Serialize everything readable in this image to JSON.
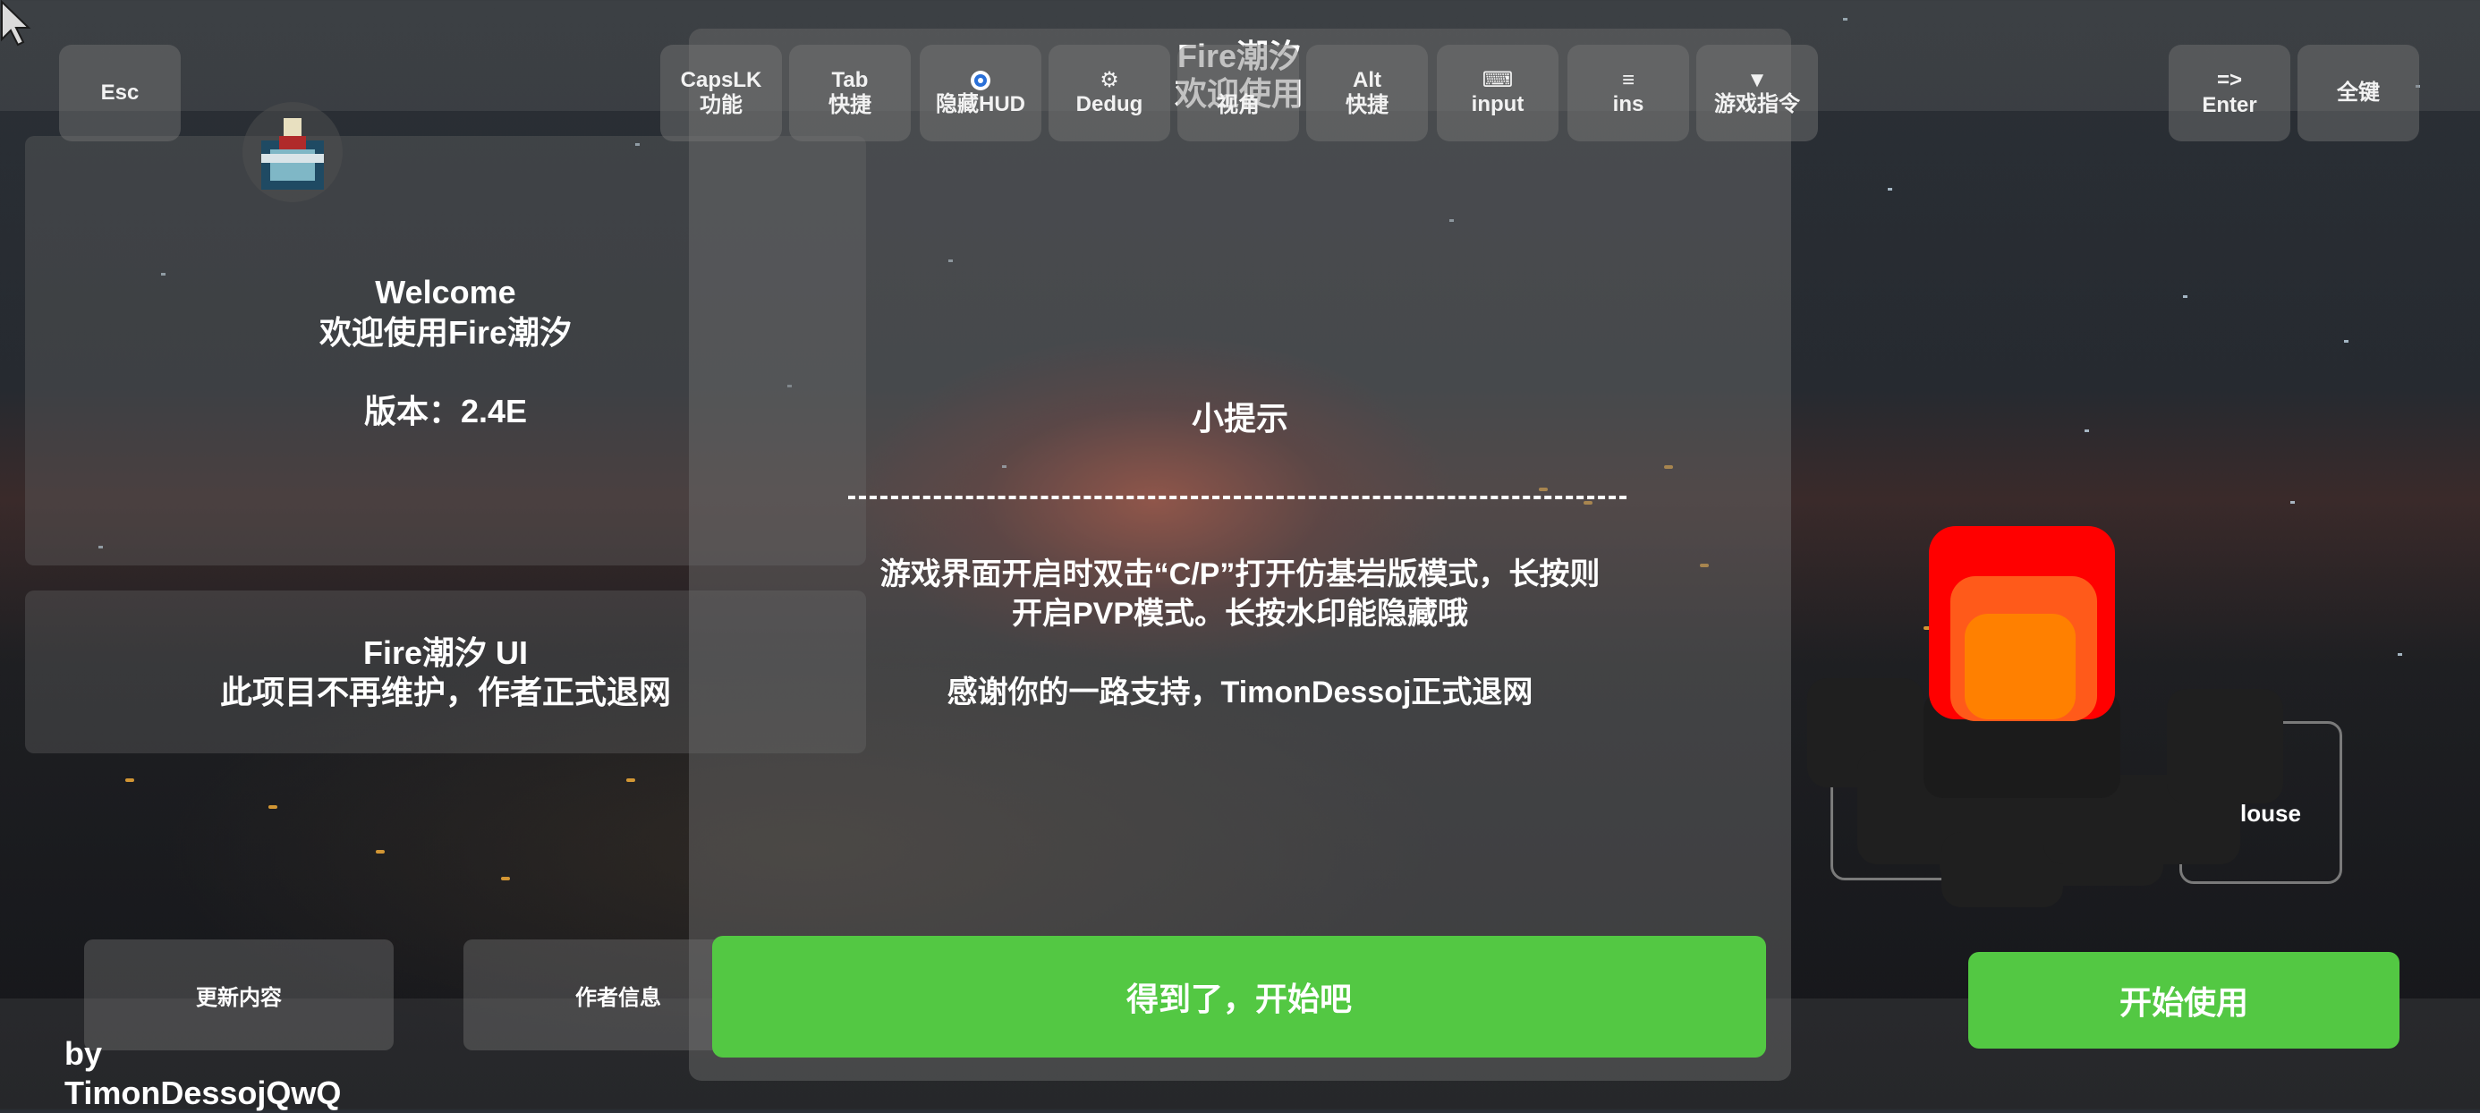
{
  "keys": {
    "esc": "Esc",
    "capslk": [
      "CapsLK",
      "功能"
    ],
    "tab": [
      "Tab",
      "快捷"
    ],
    "hud": [
      "隐藏HUD"
    ],
    "debug": [
      "Dedug"
    ],
    "view": [
      "视角"
    ],
    "alt": [
      "Alt",
      "快捷"
    ],
    "input": [
      "input"
    ],
    "ins": [
      "ins"
    ],
    "game_cmd": [
      "游戏指令"
    ],
    "enter": [
      "=>",
      "Enter"
    ],
    "all_keys": "全键"
  },
  "icons": {
    "hud": "eye-icon",
    "debug": "gear-icon",
    "input": "keyboard-icon",
    "ins": "menu-icon",
    "game_cmd": "triangle-down-icon"
  },
  "top_title": [
    "Fire潮汐",
    "欢迎使用"
  ],
  "welcome_panel": {
    "heading": "Welcome",
    "subheading": "欢迎使用Fire潮汐",
    "version": "版本：2.4E"
  },
  "info_panel": {
    "title": "Fire潮汐 UI",
    "notice": "此项目不再维护，作者正式退网"
  },
  "tip_panel": {
    "title": "小提示",
    "body_line1": "游戏界面开启时双击“C/P”打开仿基岩版模式，长按则",
    "body_line2": "开启PVP模式。长按水印能隐藏哦",
    "thanks": "感谢你的一路支持，TimonDessoj正式退网",
    "confirm_button": "得到了，开始吧"
  },
  "bottom": {
    "update_button": "更新内容",
    "author_button": "作者信息",
    "watermark": "by TimonDessojQwQ",
    "start_button": "开始使用"
  },
  "right_cluster": {
    "mouse_label": "louse"
  },
  "colors": {
    "green": "#53c843",
    "red": "#ff0000",
    "orange": "#ff8000"
  }
}
